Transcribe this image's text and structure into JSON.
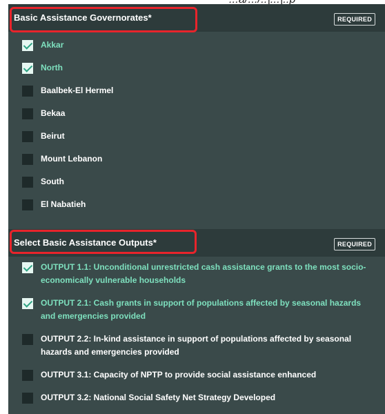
{
  "top_fragment": "...a/.../..|...|..p",
  "governorates": {
    "title": "Basic Assistance Governorates*",
    "required_label": "REQUIRED",
    "options": [
      {
        "label": "Akkar",
        "checked": true
      },
      {
        "label": "North",
        "checked": true
      },
      {
        "label": "Baalbek-El Hermel",
        "checked": false
      },
      {
        "label": "Bekaa",
        "checked": false
      },
      {
        "label": "Beirut",
        "checked": false
      },
      {
        "label": "Mount Lebanon",
        "checked": false
      },
      {
        "label": "South",
        "checked": false
      },
      {
        "label": "El Nabatieh",
        "checked": false
      }
    ]
  },
  "outputs": {
    "title": "Select Basic Assistance Outputs*",
    "required_label": "REQUIRED",
    "options": [
      {
        "label": "OUTPUT 1.1: Unconditional unrestricted cash assistance grants to the most socio-economically vulnerable households",
        "checked": true
      },
      {
        "label": "OUTPUT 2.1: Cash grants in support of populations affected by seasonal hazards and emergencies provided",
        "checked": true
      },
      {
        "label": "OUTPUT 2.2: In-kind assistance in support of populations affected by seasonal hazards and emergencies provided",
        "checked": false
      },
      {
        "label": "OUTPUT 3.1: Capacity of NPTP to provide social assistance enhanced",
        "checked": false
      },
      {
        "label": "OUTPUT 3.2: National Social Safety Net Strategy Developed",
        "checked": false
      }
    ]
  },
  "colors": {
    "panel_bg": "#3a4a4a",
    "header_bg": "#2d3b3b",
    "checked_text": "#7ee0be",
    "highlight_border": "#e8242b"
  }
}
